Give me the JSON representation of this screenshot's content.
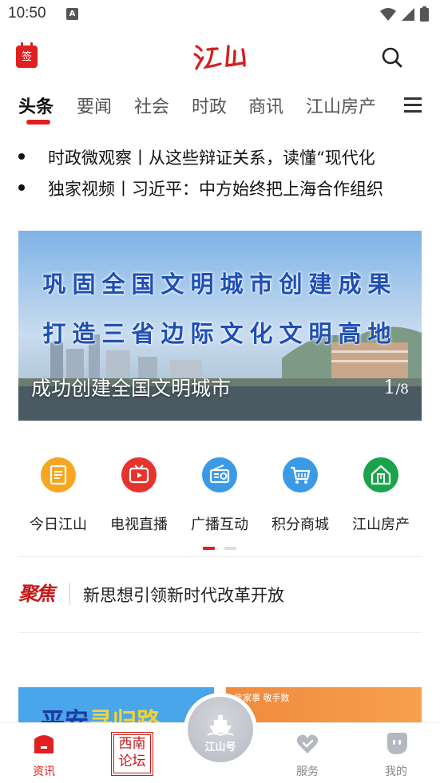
{
  "status": {
    "time": "10:50",
    "badge": "A"
  },
  "header": {
    "sign_label": "签",
    "logo_text": "江山"
  },
  "tabs": [
    {
      "label": "头条",
      "active": true
    },
    {
      "label": "要闻"
    },
    {
      "label": "社会"
    },
    {
      "label": "时政"
    },
    {
      "label": "商讯"
    },
    {
      "label": "江山房产"
    }
  ],
  "headlines": [
    "时政微观察丨从这些辩证关系，读懂“现代化",
    "独家视频丨习近平：中方始终把上海合作组织"
  ],
  "banner": {
    "line1": "巩固全国文明城市创建成果",
    "line2": "打造三省边际文化文明高地",
    "caption": "成功创建全国文明城市",
    "current": "1",
    "total": "/8"
  },
  "grid": [
    {
      "label": "今日江山",
      "icon": "news-icon",
      "color": "#f6a623"
    },
    {
      "label": "电视直播",
      "icon": "tv-icon",
      "color": "#e8322c"
    },
    {
      "label": "广播互动",
      "icon": "radio-icon",
      "color": "#3b9ae6"
    },
    {
      "label": "积分商城",
      "icon": "cart-icon",
      "color": "#3b9ae6"
    },
    {
      "label": "江山房产",
      "icon": "house-icon",
      "color": "#1aa34a"
    }
  ],
  "focus": {
    "logo": "聚焦",
    "text": "新思想引领新时代改革开放"
  },
  "cards": {
    "left_a": "平安",
    "left_b": "寻归路",
    "right": "信家事 敬手数"
  },
  "bottom_nav": [
    {
      "label": "资讯",
      "icon": "news-home-icon",
      "active": true
    },
    {
      "label": "西南论坛",
      "icon": "forum-stamp-icon"
    },
    {
      "label": "江山号",
      "icon": "ship-icon"
    },
    {
      "label": "服务",
      "icon": "heart-icon"
    },
    {
      "label": "我的",
      "icon": "profile-icon"
    }
  ],
  "forum": {
    "line1": "西南",
    "line2": "论坛"
  },
  "colors": {
    "accent": "#e02020",
    "banner_text": "#1e4fb3"
  }
}
